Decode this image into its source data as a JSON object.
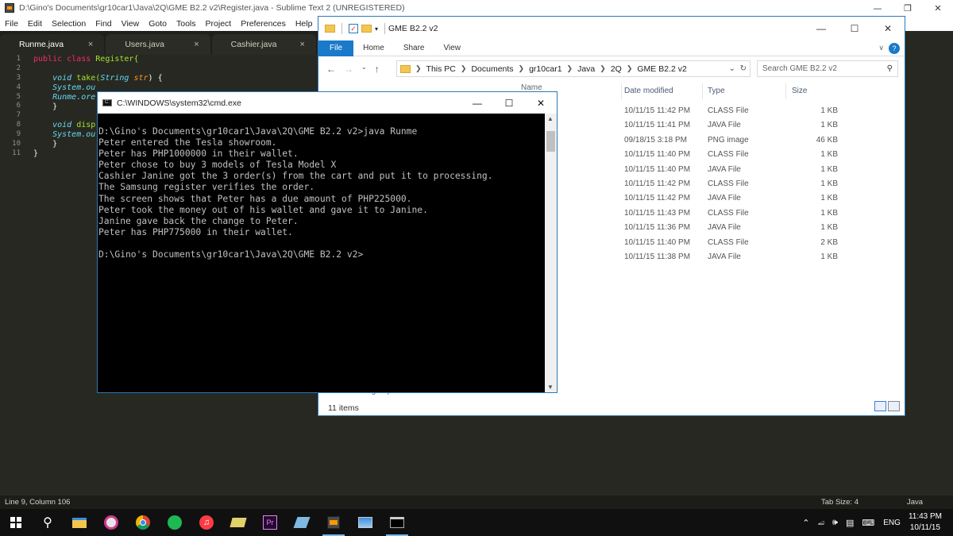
{
  "sublime": {
    "title": "D:\\Gino's Documents\\gr10car1\\Java\\2Q\\GME B2.2 v2\\Register.java - Sublime Text 2 (UNREGISTERED)",
    "menu": [
      "File",
      "Edit",
      "Selection",
      "Find",
      "View",
      "Goto",
      "Tools",
      "Project",
      "Preferences",
      "Help"
    ],
    "tabs": [
      {
        "label": "Runme.java",
        "close": "×"
      },
      {
        "label": "Users.java",
        "close": "×"
      },
      {
        "label": "Cashier.java",
        "close": "×"
      }
    ],
    "line_numbers": [
      "1",
      "2",
      "3",
      "4",
      "5",
      "6",
      "7",
      "8",
      "9",
      "10",
      "11"
    ],
    "code": {
      "l1_kw": "public class ",
      "l1_name": "Register{",
      "l3_kw": "void ",
      "l3_fn": "take(",
      "l3_type": "String ",
      "l3_par": "str",
      "l3_end": ") {",
      "l4": "System.ou",
      "l5": "Runme.ore",
      "l6": "}",
      "l8_kw": "void ",
      "l8_fn": "disp",
      "l9": "System.ou",
      "l10": "}",
      "l11": "}"
    },
    "status_left": "Line 9, Column 106",
    "status_tab": "Tab Size: 4",
    "status_syntax": "Java"
  },
  "explorer": {
    "title": "GME B2.2 v2",
    "ribbon": [
      "File",
      "Home",
      "Share",
      "View"
    ],
    "help_label": "?",
    "breadcrumb": [
      "This PC",
      "Documents",
      "gr10car1",
      "Java",
      "2Q",
      "GME B2.2 v2"
    ],
    "search_placeholder": "Search GME B2.2 v2",
    "columns": {
      "date": "Date modified",
      "type": "Type",
      "size": "Size"
    },
    "hidden_header": "Name",
    "hidden_sidebar": "Homegroup",
    "rows": [
      {
        "date": "10/11/15 11:42 PM",
        "type": "CLASS File",
        "size": "1 KB"
      },
      {
        "date": "10/11/15 11:41 PM",
        "type": "JAVA File",
        "size": "1 KB"
      },
      {
        "date": "09/18/15 3:18 PM",
        "type": "PNG image",
        "size": "46 KB"
      },
      {
        "date": "10/11/15 11:40 PM",
        "type": "CLASS File",
        "size": "1 KB"
      },
      {
        "date": "10/11/15 11:40 PM",
        "type": "JAVA File",
        "size": "1 KB"
      },
      {
        "date": "10/11/15 11:42 PM",
        "type": "CLASS File",
        "size": "1 KB"
      },
      {
        "date": "10/11/15 11:42 PM",
        "type": "JAVA File",
        "size": "1 KB"
      },
      {
        "date": "10/11/15 11:43 PM",
        "type": "CLASS File",
        "size": "1 KB"
      },
      {
        "date": "10/11/15 11:36 PM",
        "type": "JAVA File",
        "size": "1 KB"
      },
      {
        "date": "10/11/15 11:40 PM",
        "type": "CLASS File",
        "size": "2 KB"
      },
      {
        "date": "10/11/15 11:38 PM",
        "type": "JAVA File",
        "size": "1 KB"
      }
    ],
    "item_count": "11 items"
  },
  "cmd": {
    "title": "C:\\WINDOWS\\system32\\cmd.exe",
    "output": "D:\\Gino's Documents\\gr10car1\\Java\\2Q\\GME B2.2 v2>java Runme\nPeter entered the Tesla showroom.\nPeter has PHP1000000 in their wallet.\nPeter chose to buy 3 models of Tesla Model X\nCashier Janine got the 3 order(s) from the cart and put it to processing.\nThe Samsung register verifies the order.\nThe screen shows that Peter has a due amount of PHP225000.\nPeter took the money out of his wallet and gave it to Janine.\nJanine gave back the change to Peter.\nPeter has PHP775000 in their wallet.\n\nD:\\Gino's Documents\\gr10car1\\Java\\2Q\\GME B2.2 v2>"
  },
  "taskbar": {
    "apps": [
      "start-button",
      "search-icon",
      "file-explorer-icon",
      "paint-icon",
      "chrome-icon",
      "spotify-icon",
      "itunes-icon",
      "folder-icon",
      "premiere-icon",
      "notepad-icon",
      "sublime-icon",
      "photos-icon",
      "cmd-icon"
    ],
    "premiere_label": "Pr",
    "language": "ENG",
    "time": "11:43 PM",
    "date": "10/11/15"
  },
  "colors": {
    "sublime_bg": "#272822",
    "accent_blue": "#1979ca",
    "taskbar_bg": "#101010"
  }
}
